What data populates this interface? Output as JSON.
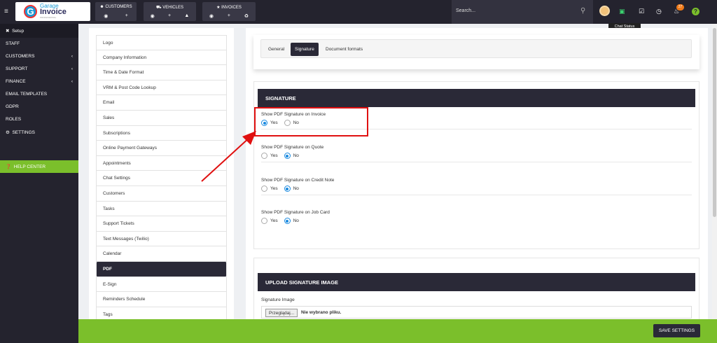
{
  "brand": {
    "line1": "Garage",
    "line2": "Invoice",
    "line3": "PROFESSIONAL"
  },
  "nav": {
    "customers": "CUSTOMERS",
    "vehicles": "VEHICLES",
    "invoices": "INVOICES"
  },
  "search": {
    "placeholder": "Search..."
  },
  "notifications": {
    "count": "27"
  },
  "tooltip": "Chat Status",
  "sidebar": {
    "setup": "Setup",
    "items": [
      {
        "label": "STAFF",
        "chevron": false
      },
      {
        "label": "CUSTOMERS",
        "chevron": true
      },
      {
        "label": "SUPPORT",
        "chevron": true
      },
      {
        "label": "FINANCE",
        "chevron": true
      },
      {
        "label": "EMAIL TEMPLATES",
        "chevron": false
      },
      {
        "label": "GDPR",
        "chevron": false
      },
      {
        "label": "ROLES",
        "chevron": false
      },
      {
        "label": "SETTINGS",
        "chevron": false
      }
    ],
    "help_center": "HELP CENTER"
  },
  "settings_menu": [
    "Logo",
    "Company Information",
    "Time & Date Format",
    "VRM & Post Code Lookup",
    "Email",
    "Sales",
    "Subscriptions",
    "Online Payment Gateways",
    "Appointments",
    "Chat Settings",
    "Customers",
    "Tasks",
    "Support Tickets",
    "Text Messages (Twilio)",
    "Calendar",
    "PDF",
    "E-Sign",
    "Reminders Schedule",
    "Tags"
  ],
  "settings_active": "PDF",
  "tabs": [
    "General",
    "Signature",
    "Document formats"
  ],
  "tab_active": "Signature",
  "signature": {
    "header": "SIGNATURE",
    "fields": [
      {
        "label": "Show PDF Signature on Invoice",
        "value": "Yes"
      },
      {
        "label": "Show PDF Signature on Quote",
        "value": "No"
      },
      {
        "label": "Show PDF Signature on Credit Note",
        "value": "No"
      },
      {
        "label": "Show PDF Signature on Job Card",
        "value": "No"
      }
    ],
    "yes": "Yes",
    "no": "No"
  },
  "upload": {
    "header": "UPLOAD SIGNATURE IMAGE",
    "label": "Signature Image",
    "button": "Przeglądaj...",
    "status": "Nie wybrano pliku."
  },
  "save_label": "SAVE SETTINGS",
  "colors": {
    "accent_green": "#7bbf2b",
    "dark": "#24232e",
    "radio_blue": "#1a8ae0",
    "annotation_red": "#e01010"
  }
}
